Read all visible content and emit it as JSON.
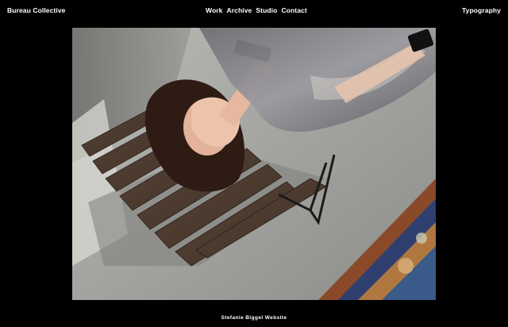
{
  "header": {
    "brand": "Bureau Collective",
    "nav": [
      "Work",
      "Archive",
      "Studio",
      "Contact"
    ],
    "right_link": "Typography"
  },
  "hero": {
    "image_subject": "woman lying on a wooden slatted bench covering her face with her hand, patterned rug on concrete floor"
  },
  "footer": {
    "caption": "Stefanie Biggel Website"
  },
  "colors": {
    "background": "#000000",
    "text": "#ffffff"
  }
}
